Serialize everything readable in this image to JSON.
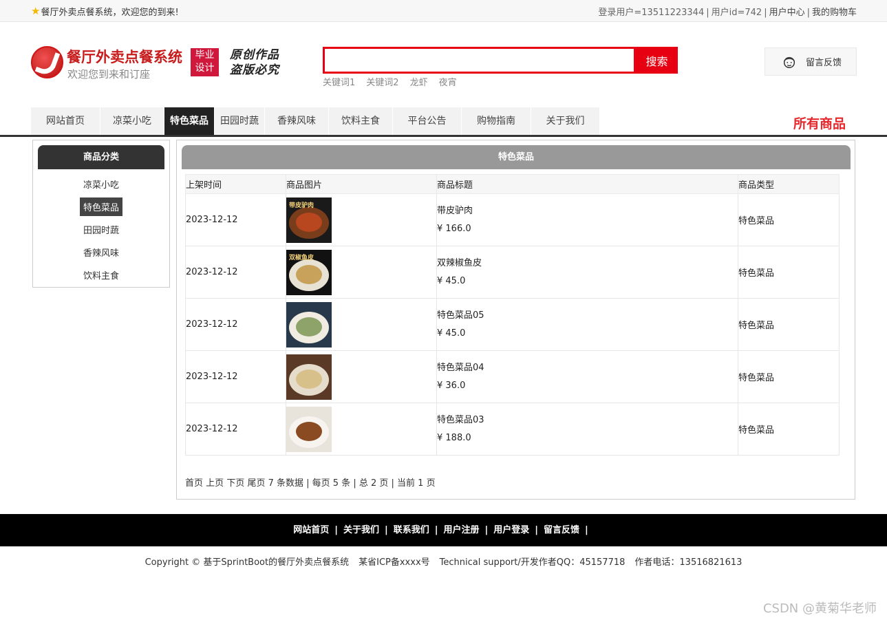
{
  "topbar": {
    "welcome": "餐厅外卖点餐系统，欢迎您的到来!",
    "login_user": "登录用户=13511223344",
    "user_id": "用户id=742",
    "user_center": "用户中心",
    "cart": "我的购物车"
  },
  "header": {
    "title": "餐厅外卖点餐系统",
    "subtitle": "欢迎您到来和订座",
    "badge_line1": "毕业",
    "badge_line2": "设计",
    "slogan_line1": "原创作品",
    "slogan_line2": "盗版必究",
    "search": {
      "value": "",
      "placeholder": "",
      "button": "搜索"
    },
    "keywords": [
      "关键词1",
      "关键词2",
      "龙虾",
      "夜宵"
    ],
    "feedback": "留言反馈"
  },
  "nav": {
    "items": [
      {
        "label": "网站首页",
        "width": 100
      },
      {
        "label": "凉菜小吃",
        "width": 92
      },
      {
        "label": "特色菜品",
        "width": 72
      },
      {
        "label": "田园时蔬",
        "width": 72
      },
      {
        "label": "香辣风味",
        "width": 92
      },
      {
        "label": "饮料主食",
        "width": 92
      },
      {
        "label": "平台公告",
        "width": 99
      },
      {
        "label": "购物指南",
        "width": 100
      },
      {
        "label": "关于我们",
        "width": 99
      }
    ],
    "active_index": 2,
    "all_goods": "所有商品"
  },
  "category": {
    "title": "商品分类",
    "items": [
      "凉菜小吃",
      "特色菜品",
      "田园时蔬",
      "香辣风味",
      "饮料主食"
    ],
    "active_index": 1
  },
  "main": {
    "title": "特色菜品",
    "columns": [
      "上架时间",
      "商品图片",
      "商品标题",
      "商品类型"
    ],
    "rows": [
      {
        "date": "2023-12-12",
        "title": "带皮驴肉",
        "price": "¥ 166.0",
        "type": "特色菜品",
        "img_tag": "带皮驴肉",
        "bg": "#1a1a1a",
        "plate": "#7a3d1c",
        "food": "#b8461e"
      },
      {
        "date": "2023-12-12",
        "title": "双辣椒鱼皮",
        "price": "¥ 45.0",
        "type": "特色菜品",
        "img_tag": "双椒鱼皮",
        "bg": "#111111",
        "plate": "#e8e2d4",
        "food": "#c8a25a"
      },
      {
        "date": "2023-12-12",
        "title": "特色菜品05",
        "price": "¥ 45.0",
        "type": "特色菜品",
        "img_tag": "",
        "bg": "#27394a",
        "plate": "#f0ece2",
        "food": "#8ea36a"
      },
      {
        "date": "2023-12-12",
        "title": "特色菜品04",
        "price": "¥ 36.0",
        "type": "特色菜品",
        "img_tag": "",
        "bg": "#5a3a26",
        "plate": "#e6dccb",
        "food": "#d7c08a"
      },
      {
        "date": "2023-12-12",
        "title": "特色菜品03",
        "price": "¥ 188.0",
        "type": "特色菜品",
        "img_tag": "",
        "bg": "#e8e4dc",
        "plate": "#f7f4ef",
        "food": "#8a4a22"
      }
    ],
    "pager": {
      "first": "首页",
      "prev": "上页",
      "next": "下页",
      "last": "尾页",
      "summary": "7 条数据 | 每页 5 条 | 总 2 页 | 当前 1 页"
    }
  },
  "footer": {
    "links": [
      "网站首页",
      "关于我们",
      "联系我们",
      "用户注册",
      "用户登录",
      "留言反馈"
    ],
    "copyright": "Copyright © 基于SprintBoot的餐厅外卖点餐系统",
    "icp": "某省ICP备xxxx号",
    "support": "Technical support/开发作者QQ：45157718",
    "phone": "作者电话：13516821613"
  },
  "watermark": "CSDN @黄菊华老师"
}
